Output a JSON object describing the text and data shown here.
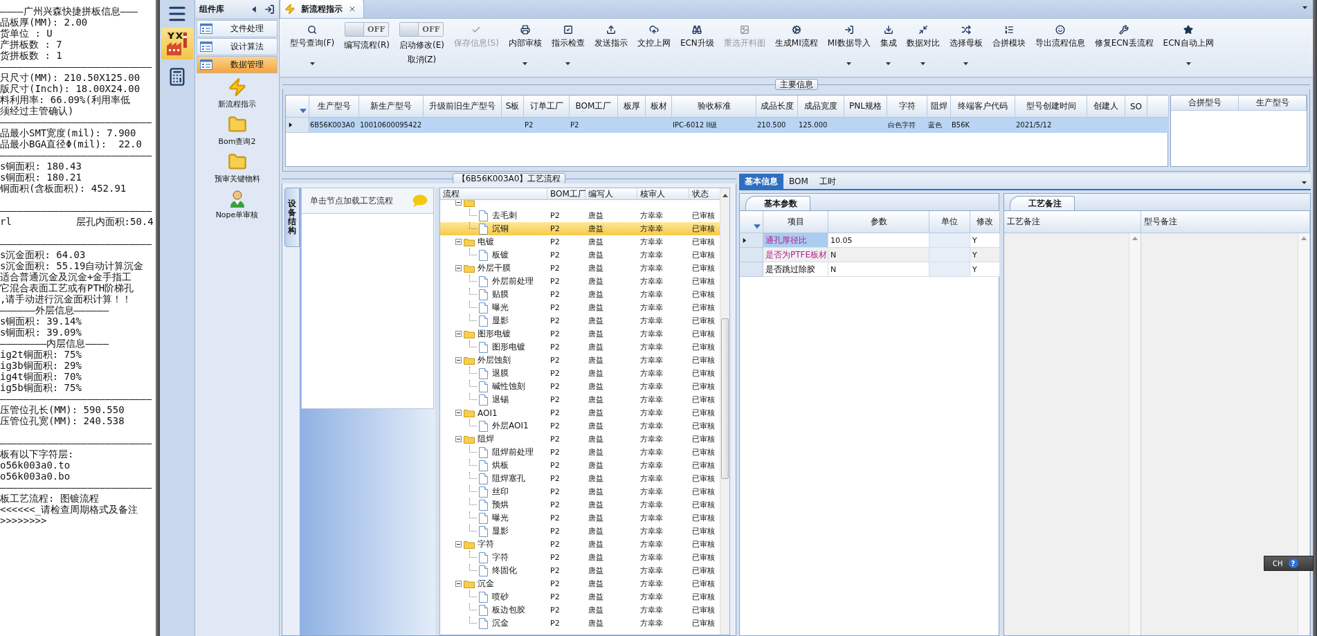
{
  "log_panel": {
    "lines": [
      {
        "kind": "text",
        "text": "————广州兴森快捷拼板信息———"
      },
      {
        "kind": "text",
        "text": "品板厚(MM): 2.00"
      },
      {
        "kind": "text",
        "text": "货单位 : U"
      },
      {
        "kind": "text",
        "text": "产拼板数 : 7"
      },
      {
        "kind": "text",
        "text": "货拼板数 : 1"
      },
      {
        "kind": "text",
        "text": "——————————————————————————"
      },
      {
        "kind": "text",
        "text": "只尺寸(MM): 210.50X125.00"
      },
      {
        "kind": "text",
        "text": "版尺寸(Inch): 18.00X24.00"
      },
      {
        "kind": "text",
        "text": "料利用率: 66.09%(利用率低"
      },
      {
        "kind": "text",
        "text": "须经过主管确认)"
      },
      {
        "kind": "text",
        "text": "——————————————————————————"
      },
      {
        "kind": "text",
        "text": "品最小SMT宽度(mil): 7.900"
      },
      {
        "kind": "text",
        "text": "品最小BGA直径Φ(mil):  22.0"
      },
      {
        "kind": "text",
        "text": "——————————————————————————"
      },
      {
        "kind": "text",
        "text": "s铜面积: 180.43"
      },
      {
        "kind": "text",
        "text": "s铜面积: 180.21"
      },
      {
        "kind": "text",
        "text": "铜面积(含板面积): 452.91"
      },
      {
        "kind": "gap"
      },
      {
        "kind": "text",
        "text": "——————————————————————————"
      },
      {
        "kind": "text",
        "text": "rl           层孔内面积:50.4"
      },
      {
        "kind": "gap"
      },
      {
        "kind": "text",
        "text": "——————————————————————————"
      },
      {
        "kind": "text",
        "text": "s沉金面积: 64.03"
      },
      {
        "kind": "text",
        "text": "s沉金面积: 55.19自动计算沉金"
      },
      {
        "kind": "text",
        "text": "适合普通沉金及沉金+金手指工"
      },
      {
        "kind": "text",
        "text": "它混合表面工艺或有PTH阶梯孔"
      },
      {
        "kind": "text",
        "text": ",请手动进行沉金面积计算！！"
      },
      {
        "kind": "text",
        "text": "——————外层信息——————"
      },
      {
        "kind": "text",
        "text": "s铜面积: 39.14%"
      },
      {
        "kind": "text",
        "text": "s铜面积: 39.09%"
      },
      {
        "kind": "text",
        "text": "————————内层信息————"
      },
      {
        "kind": "text",
        "text": "ig2t铜面积: 75%"
      },
      {
        "kind": "text",
        "text": "ig3b铜面积: 29%"
      },
      {
        "kind": "text",
        "text": "ig4t铜面积: 70%"
      },
      {
        "kind": "text",
        "text": "ig5b铜面积: 75%"
      },
      {
        "kind": "text",
        "text": "——————————————————————————"
      },
      {
        "kind": "text",
        "text": "压管位孔长(MM): 590.550"
      },
      {
        "kind": "text",
        "text": "压管位孔宽(MM): 240.538"
      },
      {
        "kind": "gap"
      },
      {
        "kind": "text",
        "text": "——————————————————————————"
      },
      {
        "kind": "text",
        "text": "板有以下字符层:"
      },
      {
        "kind": "text",
        "text": "o56k003a0.to"
      },
      {
        "kind": "text",
        "text": "o56k003a0.bo"
      },
      {
        "kind": "text",
        "text": "——————————————————————————"
      },
      {
        "kind": "text",
        "text": "板工艺流程: 图镀流程"
      },
      {
        "kind": "text",
        "text": "<<<<<<_请检查周期格式及备注"
      },
      {
        "kind": "text",
        "text": ">>>>>>>>"
      }
    ]
  },
  "nav_rail": {
    "items": [
      {
        "kind": "menu",
        "selected": false
      },
      {
        "kind": "factory",
        "selected": true
      },
      {
        "kind": "calculator",
        "selected": false
      }
    ]
  },
  "component_library": {
    "title": "组件库",
    "categories": [
      {
        "label": "文件处理",
        "selected": false
      },
      {
        "label": "设计算法",
        "selected": false
      },
      {
        "label": "数据管理",
        "selected": true
      }
    ],
    "tools": [
      {
        "kind": "lightning",
        "label": "新流程指示"
      },
      {
        "kind": "folder",
        "label": "Bom查询2"
      },
      {
        "kind": "folder",
        "label": "预审关键物料"
      },
      {
        "kind": "person",
        "label": "Nope单审核"
      }
    ]
  },
  "document_tabs": [
    {
      "label": "新流程指示",
      "selected": true
    }
  ],
  "toolbar": [
    {
      "kind": "search",
      "label": "型号查询(F)",
      "dropdown": true,
      "disabled": false
    },
    {
      "kind": "toggle",
      "state_text": "OFF",
      "on": false,
      "label": "编写流程(R)"
    },
    {
      "kind": "toggle",
      "state_text": "OFF",
      "on": false,
      "label": "启动修改(E)",
      "sublabel": "取消(Z)"
    },
    {
      "kind": "check",
      "label": "保存信息(S)",
      "dropdown": false,
      "disabled": true
    },
    {
      "kind": "print",
      "label": "内部审核",
      "dropdown": true,
      "disabled": false
    },
    {
      "kind": "checklist",
      "label": "指示检查",
      "dropdown": true,
      "disabled": false
    },
    {
      "kind": "upload",
      "label": "发送指示",
      "dropdown": false,
      "disabled": false
    },
    {
      "kind": "cloud",
      "label": "文控上网",
      "dropdown": false,
      "disabled": false
    },
    {
      "kind": "binoculars",
      "label": "ECN升级",
      "dropdown": false,
      "disabled": false
    },
    {
      "kind": "image",
      "label": "重选开料图",
      "dropdown": false,
      "disabled": true
    },
    {
      "kind": "gears",
      "label": "生成MI流程",
      "dropdown": false,
      "disabled": false
    },
    {
      "kind": "signin",
      "label": "MI数据导入",
      "dropdown": true,
      "disabled": false
    },
    {
      "kind": "download",
      "label": "集成",
      "dropdown": true,
      "disabled": false
    },
    {
      "kind": "compress",
      "label": "数据对比",
      "dropdown": true,
      "disabled": false
    },
    {
      "kind": "shuffle",
      "label": "选择母板",
      "dropdown": true,
      "disabled": false
    },
    {
      "kind": "list",
      "label": "合拼模块",
      "dropdown": false,
      "disabled": false
    },
    {
      "kind": "smile",
      "label": "导出流程信息",
      "dropdown": false,
      "disabled": false
    },
    {
      "kind": "wrench",
      "label": "修复ECN丢流程",
      "dropdown": false,
      "disabled": false
    },
    {
      "kind": "star",
      "label": "ECN自动上网",
      "dropdown": true,
      "disabled": false
    }
  ],
  "main_info": {
    "title": "主要信息",
    "columns": [
      "生产型号",
      "新生产型号",
      "升级前旧生产型号",
      "S板",
      "订单工厂",
      "BOM工厂",
      "板厚",
      "板材",
      "验收标准",
      "成品长度",
      "成品宽度",
      "PNL规格",
      "字符",
      "阻焊",
      "终端客户代码",
      "型号创建时间",
      "创建人",
      "SO"
    ],
    "rows": [
      {
        "selected": true,
        "cells": [
          "6B56K003A0",
          "10010600095422",
          null,
          null,
          "P2",
          "P2",
          null,
          null,
          "IPC-6012 II级",
          "210.500",
          "125.000",
          null,
          "白色字符",
          "蓝色",
          "B56K",
          "2021/5/12",
          null,
          null
        ]
      }
    ],
    "side_columns": [
      "合拼型号",
      "生产型号"
    ]
  },
  "process": {
    "title": "【6B56K003A0】工艺流程",
    "side_tab": "设备结构",
    "hint": "单击节点加载工艺流程",
    "columns": [
      "流程",
      "BOM工厂",
      "编写人",
      "核审人",
      "状态"
    ],
    "tree": [
      {
        "expanded": true,
        "children": [
          {
            "label": "去毛刺",
            "bom": "P2",
            "writer": "唐益",
            "reviewer": "方幸幸",
            "status": "已审核",
            "selected": false
          },
          {
            "label": "沉铜",
            "bom": "P2",
            "writer": "唐益",
            "reviewer": "方幸幸",
            "status": "已审核",
            "selected": true
          }
        ]
      },
      {
        "label": "电镀",
        "bom": "P2",
        "writer": "唐益",
        "reviewer": "方幸幸",
        "status": "已审核",
        "selected": false,
        "expanded": true,
        "children": [
          {
            "label": "板镀",
            "bom": "P2",
            "writer": "唐益",
            "reviewer": "方幸幸",
            "status": "已审核",
            "selected": false
          }
        ]
      },
      {
        "label": "外层干膜",
        "bom": "P2",
        "writer": "唐益",
        "reviewer": "方幸幸",
        "status": "已审核",
        "selected": false,
        "expanded": true,
        "children": [
          {
            "label": "外层前处理",
            "bom": "P2",
            "writer": "唐益",
            "reviewer": "方幸幸",
            "status": "已审核",
            "selected": false
          },
          {
            "label": "贴膜",
            "bom": "P2",
            "writer": "唐益",
            "reviewer": "方幸幸",
            "status": "已审核",
            "selected": false
          },
          {
            "label": "曝光",
            "bom": "P2",
            "writer": "唐益",
            "reviewer": "方幸幸",
            "status": "已审核",
            "selected": false
          },
          {
            "label": "显影",
            "bom": "P2",
            "writer": "唐益",
            "reviewer": "方幸幸",
            "status": "已审核",
            "selected": false
          }
        ]
      },
      {
        "label": "图形电镀",
        "bom": "P2",
        "writer": "唐益",
        "reviewer": "方幸幸",
        "status": "已审核",
        "selected": false,
        "expanded": true,
        "children": [
          {
            "label": "图形电镀",
            "bom": "P2",
            "writer": "唐益",
            "reviewer": "方幸幸",
            "status": "已审核",
            "selected": false
          }
        ]
      },
      {
        "label": "外层蚀刻",
        "bom": "P2",
        "writer": "唐益",
        "reviewer": "方幸幸",
        "status": "已审核",
        "selected": false,
        "expanded": true,
        "children": [
          {
            "label": "退膜",
            "bom": "P2",
            "writer": "唐益",
            "reviewer": "方幸幸",
            "status": "已审核",
            "selected": false
          },
          {
            "label": "碱性蚀刻",
            "bom": "P2",
            "writer": "唐益",
            "reviewer": "方幸幸",
            "status": "已审核",
            "selected": false
          },
          {
            "label": "退锡",
            "bom": "P2",
            "writer": "唐益",
            "reviewer": "方幸幸",
            "status": "已审核",
            "selected": false
          }
        ]
      },
      {
        "label": "AOI1",
        "bom": "P2",
        "writer": "唐益",
        "reviewer": "方幸幸",
        "status": "已审核",
        "selected": false,
        "expanded": true,
        "children": [
          {
            "label": "外层AOI1",
            "bom": "P2",
            "writer": "唐益",
            "reviewer": "方幸幸",
            "status": "已审核",
            "selected": false
          }
        ]
      },
      {
        "label": "阻焊",
        "bom": "P2",
        "writer": "唐益",
        "reviewer": "方幸幸",
        "status": "已审核",
        "selected": false,
        "expanded": true,
        "children": [
          {
            "label": "阻焊前处理",
            "bom": "P2",
            "writer": "唐益",
            "reviewer": "方幸幸",
            "status": "已审核",
            "selected": false
          },
          {
            "label": "烘板",
            "bom": "P2",
            "writer": "唐益",
            "reviewer": "方幸幸",
            "status": "已审核",
            "selected": false
          },
          {
            "label": "阻焊塞孔",
            "bom": "P2",
            "writer": "唐益",
            "reviewer": "方幸幸",
            "status": "已审核",
            "selected": false
          },
          {
            "label": "丝印",
            "bom": "P2",
            "writer": "唐益",
            "reviewer": "方幸幸",
            "status": "已审核",
            "selected": false
          },
          {
            "label": "预烘",
            "bom": "P2",
            "writer": "唐益",
            "reviewer": "方幸幸",
            "status": "已审核",
            "selected": false
          },
          {
            "label": "曝光",
            "bom": "P2",
            "writer": "唐益",
            "reviewer": "方幸幸",
            "status": "已审核",
            "selected": false
          },
          {
            "label": "显影",
            "bom": "P2",
            "writer": "唐益",
            "reviewer": "方幸幸",
            "status": "已审核",
            "selected": false
          }
        ]
      },
      {
        "label": "字符",
        "bom": "P2",
        "writer": "唐益",
        "reviewer": "方幸幸",
        "status": "已审核",
        "selected": false,
        "expanded": true,
        "children": [
          {
            "label": "字符",
            "bom": "P2",
            "writer": "唐益",
            "reviewer": "方幸幸",
            "status": "已审核",
            "selected": false
          },
          {
            "label": "终固化",
            "bom": "P2",
            "writer": "唐益",
            "reviewer": "方幸幸",
            "status": "已审核",
            "selected": false
          }
        ]
      },
      {
        "label": "沉金",
        "bom": "P2",
        "writer": "唐益",
        "reviewer": "方幸幸",
        "status": "已审核",
        "selected": false,
        "expanded": true,
        "children": [
          {
            "label": "喷砂",
            "bom": "P2",
            "writer": "唐益",
            "reviewer": "方幸幸",
            "status": "已审核",
            "selected": false
          },
          {
            "label": "板边包胶",
            "bom": "P2",
            "writer": "唐益",
            "reviewer": "方幸幸",
            "status": "已审核",
            "selected": false
          },
          {
            "label": "沉金",
            "bom": "P2",
            "writer": "唐益",
            "reviewer": "方幸幸",
            "status": "已审核",
            "selected": false
          }
        ]
      }
    ]
  },
  "detail": {
    "tabs": [
      {
        "label": "基本信息",
        "selected": true
      },
      {
        "label": "BOM",
        "selected": false
      },
      {
        "label": "工时",
        "selected": false
      }
    ],
    "params": {
      "tab": "基本参数",
      "columns": [
        "项目",
        "参数",
        "单位",
        "修改"
      ],
      "rows": [
        {
          "item": "通孔厚径比",
          "value": "10.05",
          "modified": "Y",
          "selected": true,
          "highlighted": true
        },
        {
          "item": "是否为PTFE板材",
          "value": "N",
          "modified": "Y",
          "selected": false,
          "highlighted": true
        },
        {
          "item": "是否跳过除胶",
          "value": "N",
          "modified": "Y",
          "selected": false,
          "highlighted": false
        }
      ]
    },
    "remarks": {
      "tab": "工艺备注",
      "columns": [
        "工艺备注",
        "型号备注"
      ]
    }
  },
  "ime": {
    "label": "CH",
    "help": "?"
  }
}
